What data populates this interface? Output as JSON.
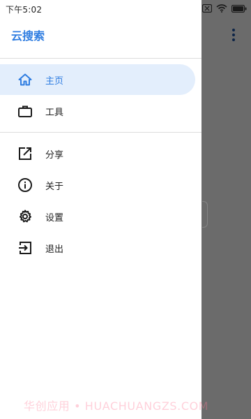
{
  "status_bar": {
    "time": "下午5:02"
  },
  "drawer": {
    "title": "云搜索",
    "items": [
      {
        "label": "主页",
        "icon": "home-icon",
        "active": true
      },
      {
        "label": "工具",
        "icon": "briefcase-icon",
        "active": false
      },
      {
        "label": "分享",
        "icon": "share-icon",
        "active": false
      },
      {
        "label": "关于",
        "icon": "info-icon",
        "active": false
      },
      {
        "label": "设置",
        "icon": "gear-icon",
        "active": false
      },
      {
        "label": "退出",
        "icon": "exit-icon",
        "active": false
      }
    ]
  },
  "watermark": {
    "text": "华创应用 • HUACHUANGZS.COM"
  },
  "colors": {
    "accent": "#2f7de1",
    "active_bg": "#e3eefc",
    "scrim": "rgba(0,0,0,0.58)"
  }
}
